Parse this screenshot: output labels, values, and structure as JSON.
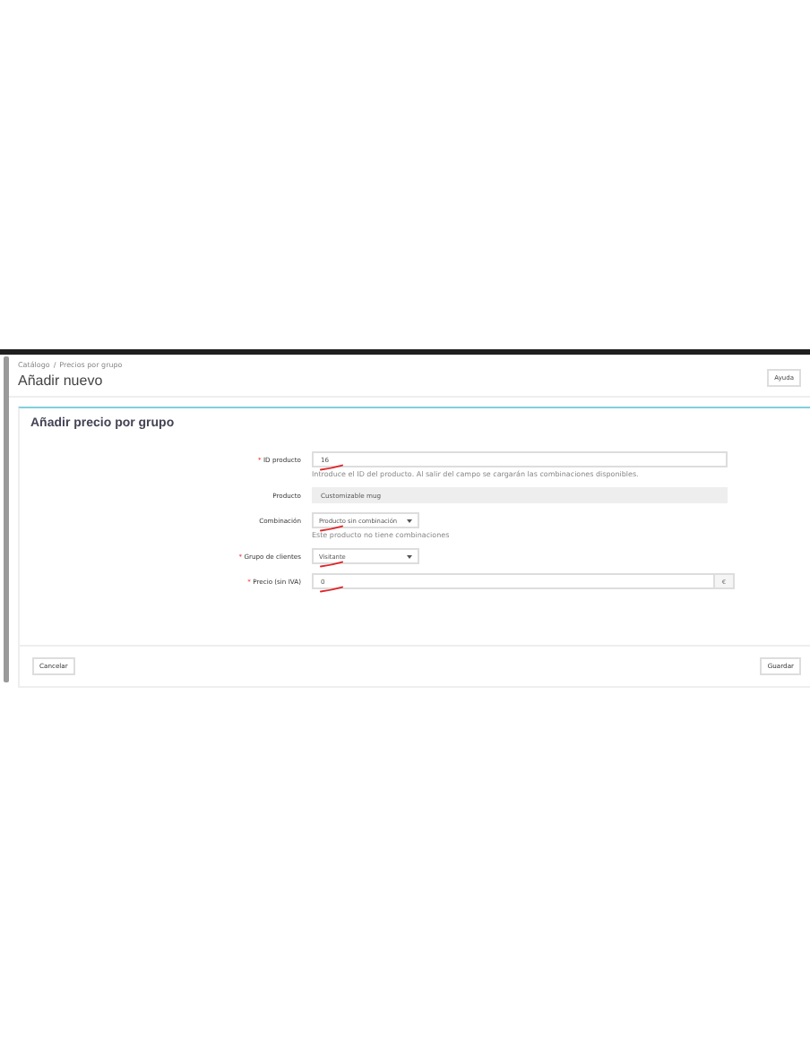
{
  "breadcrumb": [
    "Catálogo",
    "Precios por grupo"
  ],
  "breadcrumb_separator": "/",
  "title": "Añadir nuevo",
  "help_button": "Ayuda",
  "panel": {
    "heading": "Añadir precio por grupo",
    "fields": [
      {
        "kind": "input",
        "label": "ID producto",
        "required_mark": "*",
        "value": "16",
        "help": "Introduce el ID del producto. Al salir del campo se cargarán las combinaciones disponibles.",
        "marked": true
      },
      {
        "kind": "readonly",
        "label": "Producto",
        "value": "Customizable mug"
      },
      {
        "kind": "select",
        "label": "Combinación",
        "value": "Producto sin combinación",
        "help": "Este producto no tiene combinaciones",
        "marked": true
      },
      {
        "kind": "select",
        "label": "Grupo de clientes",
        "required_mark": "*",
        "value": "Visitante",
        "marked": true
      },
      {
        "kind": "addon",
        "label": "Precio (sin IVA)",
        "required_mark": "*",
        "value": "0",
        "addon": "€",
        "marked": true
      }
    ]
  },
  "buttons": {
    "cancel": "Cancelar",
    "save": "Guardar"
  }
}
